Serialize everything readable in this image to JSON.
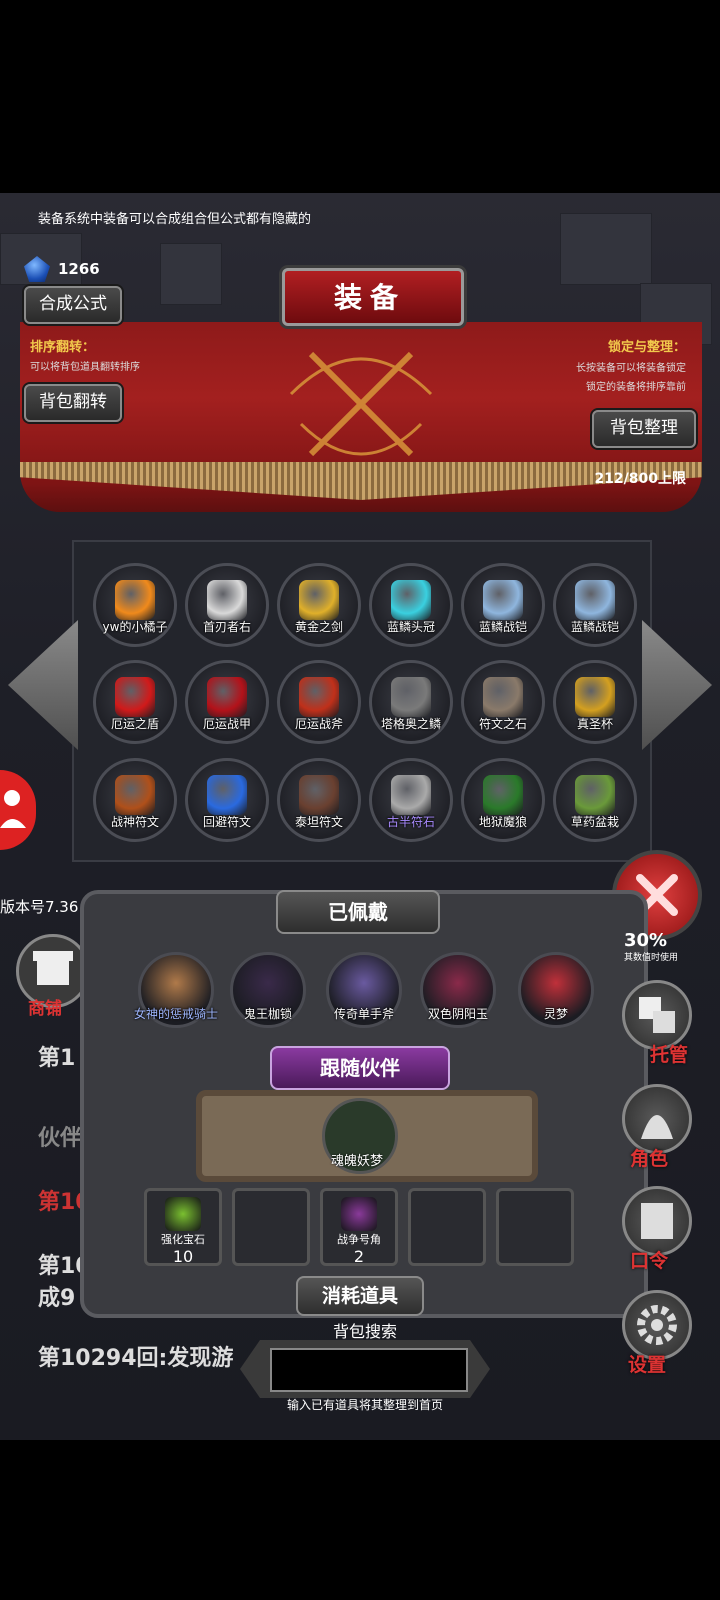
{
  "tip": "装备系统中装备可以合成组合但公式都有隐藏的",
  "currency": {
    "value": "1266",
    "icon": "blue-gem-icon"
  },
  "title": "装备",
  "buttons": {
    "synth": "合成公式",
    "bag_flip": "背包翻转",
    "bag_sort": "背包整理"
  },
  "sort_flip": {
    "label": "排序翻转：",
    "desc": "可以将背包道具翻转排序"
  },
  "lock_sort": {
    "label": "锁定与整理：",
    "desc1": "长按装备可以将装备锁定",
    "desc2": "锁定的装备将排序靠前"
  },
  "capacity": "212/800上限",
  "items": [
    {
      "name": "yw的小橘子",
      "color": "#f08a1c"
    },
    {
      "name": "首刃者右",
      "color": "#d9d9d9"
    },
    {
      "name": "黄金之剑",
      "color": "#e0b02a"
    },
    {
      "name": "蓝鳞头冠",
      "color": "#3ad0e0"
    },
    {
      "name": "蓝鳞战铠",
      "color": "#8fb6de"
    },
    {
      "name": "蓝鳞战铠",
      "color": "#8fb6de"
    },
    {
      "name": "厄运之盾",
      "color": "#d11a1a"
    },
    {
      "name": "厄运战甲",
      "color": "#b3121a"
    },
    {
      "name": "厄运战斧",
      "color": "#c0301a"
    },
    {
      "name": "塔格奥之鳞",
      "color": "#7a7a7a"
    },
    {
      "name": "符文之石",
      "color": "#8a7a6a"
    },
    {
      "name": "真圣杯",
      "color": "#d4a020"
    },
    {
      "name": "战神符文",
      "color": "#b0501a"
    },
    {
      "name": "回避符文",
      "color": "#2a6ae0"
    },
    {
      "name": "泰坦符文",
      "color": "#6a4030"
    },
    {
      "name": "古半符石",
      "color": "#aaaaaa",
      "label_color": "#a98bff"
    },
    {
      "name": "地狱魔狼",
      "color": "#2a7a2a"
    },
    {
      "name": "草药盆栽",
      "color": "#6a9a3a"
    }
  ],
  "version": "版本号7.36",
  "shop_label": "商铺",
  "worn": {
    "title": "已佩戴",
    "items": [
      {
        "name": "女神的惩戒骑士",
        "color": "#b07a4a",
        "label_color": "#9fb7ff"
      },
      {
        "name": "鬼王枷锁",
        "color": "#3a2a4a"
      },
      {
        "name": "传奇单手斧",
        "color": "#6a5aa0"
      },
      {
        "name": "双色阴阳玉",
        "color": "#8a2a4a"
      },
      {
        "name": "灵梦",
        "color": "#c0303a"
      }
    ]
  },
  "partner": {
    "title": "跟随伙伴",
    "name": "魂魄妖梦"
  },
  "consumables": {
    "title": "消耗道具",
    "items": [
      {
        "name": "强化宝石",
        "count": "10",
        "color": "#7ac030"
      },
      {
        "name": "",
        "count": "",
        "color": ""
      },
      {
        "name": "战争号角",
        "count": "2",
        "color": "#8a3a9a"
      },
      {
        "name": "",
        "count": "",
        "color": ""
      },
      {
        "name": "",
        "count": "",
        "color": ""
      }
    ]
  },
  "search": {
    "title": "背包搜索",
    "hint": "输入已有道具将其整理到首页"
  },
  "side": {
    "percent": "30%",
    "percent_sub": "其数值时使用",
    "manage": "托管",
    "role": "角色",
    "code": "口令",
    "settings": "设置"
  },
  "log": {
    "line1": "第1",
    "line2": "伙伴",
    "line3": "第10",
    "line4": "第10",
    "line5": "成9",
    "line6": "第10294回:发现游"
  }
}
